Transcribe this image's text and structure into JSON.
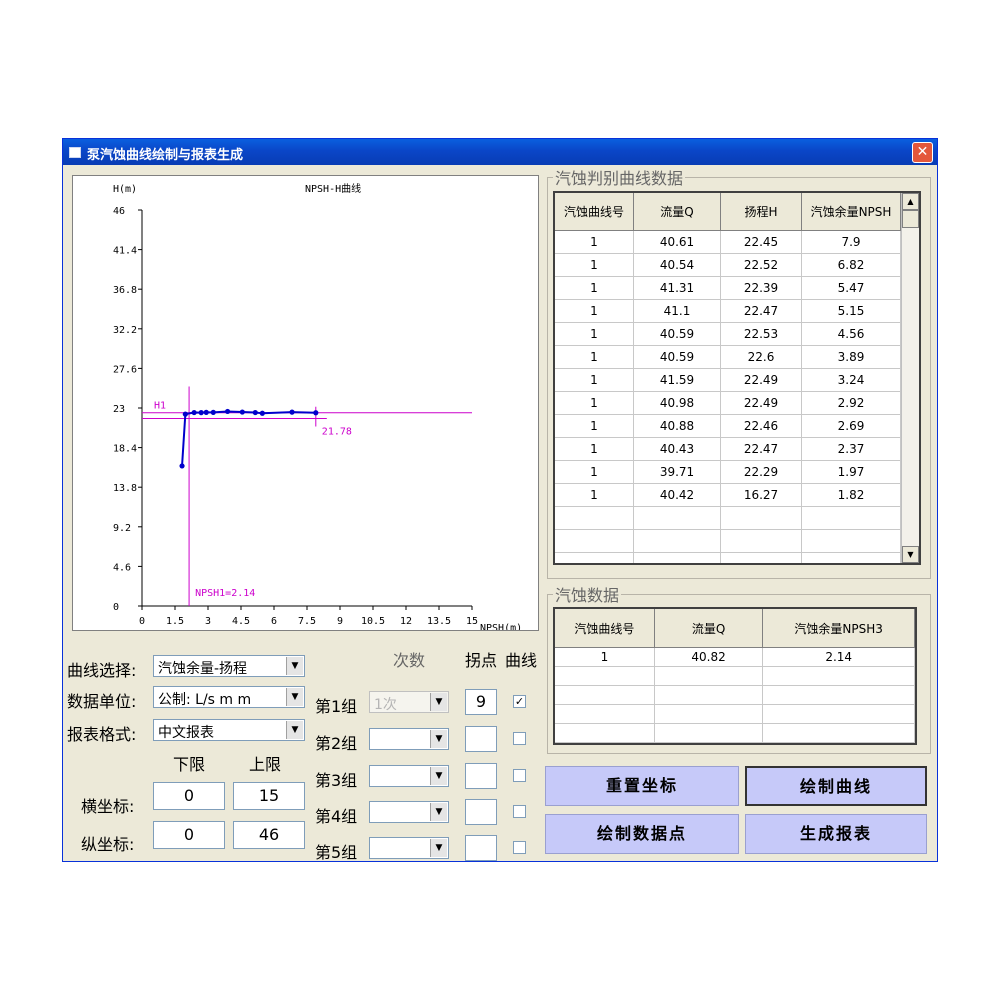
{
  "window": {
    "title": "泵汽蚀曲线绘制与报表生成",
    "close": "✕"
  },
  "plot": {
    "axes": {
      "ylabel": "H(m)",
      "xlabel": "NPSH(m)",
      "title": "NPSH-H曲线"
    },
    "chart_data": {
      "type": "scatter",
      "title": "NPSH-H曲线",
      "xlabel": "NPSH(m)",
      "ylabel": "H(m)",
      "xlim": [
        0,
        15
      ],
      "ylim": [
        0,
        46
      ],
      "x_ticks": [
        "0",
        "1.5",
        "3",
        "4.5",
        "6",
        "7.5",
        "9",
        "10.5",
        "12",
        "13.5",
        "15"
      ],
      "y_ticks": [
        "0",
        "4.6",
        "9.2",
        "13.8",
        "18.4",
        "23",
        "27.6",
        "32.2",
        "36.8",
        "41.4",
        "46"
      ],
      "series": [
        {
          "x": [
            7.9,
            6.82,
            5.47,
            5.15,
            4.56,
            3.89,
            3.24,
            2.92,
            2.69,
            2.37,
            1.97,
            1.82
          ],
          "y": [
            22.45,
            22.52,
            22.39,
            22.47,
            22.53,
            22.6,
            22.49,
            22.49,
            22.46,
            22.47,
            22.29,
            16.27
          ]
        }
      ],
      "annotations": {
        "h_line_label": "H1",
        "h_line_y": 22.45,
        "v_line_label": "NPSH1=2.14",
        "v_line_x": 2.14,
        "drop_line_y": 21.78,
        "drop_label": "21.78"
      },
      "grid": false,
      "legend": "none"
    }
  },
  "colors": {
    "series": "#0000cc",
    "guide": "#cc00cc"
  },
  "controls": {
    "curve_select_label": "曲线选择:",
    "curve_select_value": "汽蚀余量-扬程",
    "unit_label": "数据单位:",
    "unit_value": "公制: L/s m m",
    "report_label": "报表格式:",
    "report_value": "中文报表",
    "lower_label": "下限",
    "upper_label": "上限",
    "x_axis_label": "横坐标:",
    "x_lower": "0",
    "x_upper": "15",
    "y_axis_label": "纵坐标:",
    "y_lower": "0",
    "y_upper": "46",
    "count_header": "次数",
    "inflection_header": "拐点",
    "curve_header": "曲线",
    "groups": [
      {
        "label": "第1组",
        "count": "1次",
        "inflection": "9",
        "checked": "✓"
      },
      {
        "label": "第2组",
        "count": "",
        "inflection": "",
        "checked": ""
      },
      {
        "label": "第3组",
        "count": "",
        "inflection": "",
        "checked": ""
      },
      {
        "label": "第4组",
        "count": "",
        "inflection": "",
        "checked": ""
      },
      {
        "label": "第5组",
        "count": "",
        "inflection": "",
        "checked": ""
      }
    ]
  },
  "table1": {
    "title": "汽蚀判别曲线数据",
    "headers": [
      "汽蚀曲线号",
      "流量Q",
      "扬程H",
      "汽蚀余量NPSH"
    ],
    "rows": [
      [
        "1",
        "40.61",
        "22.45",
        "7.9"
      ],
      [
        "1",
        "40.54",
        "22.52",
        "6.82"
      ],
      [
        "1",
        "41.31",
        "22.39",
        "5.47"
      ],
      [
        "1",
        "41.1",
        "22.47",
        "5.15"
      ],
      [
        "1",
        "40.59",
        "22.53",
        "4.56"
      ],
      [
        "1",
        "40.59",
        "22.6",
        "3.89"
      ],
      [
        "1",
        "41.59",
        "22.49",
        "3.24"
      ],
      [
        "1",
        "40.98",
        "22.49",
        "2.92"
      ],
      [
        "1",
        "40.88",
        "22.46",
        "2.69"
      ],
      [
        "1",
        "40.43",
        "22.47",
        "2.37"
      ],
      [
        "1",
        "39.71",
        "22.29",
        "1.97"
      ],
      [
        "1",
        "40.42",
        "16.27",
        "1.82"
      ],
      [
        "",
        "",
        "",
        ""
      ],
      [
        "",
        "",
        "",
        ""
      ],
      [
        "",
        "",
        "",
        ""
      ]
    ]
  },
  "table2": {
    "title": "汽蚀数据",
    "headers": [
      "汽蚀曲线号",
      "流量Q",
      "汽蚀余量NPSH3"
    ],
    "rows": [
      [
        "1",
        "40.82",
        "2.14"
      ],
      [
        "",
        "",
        ""
      ],
      [
        "",
        "",
        ""
      ],
      [
        "",
        "",
        ""
      ],
      [
        "",
        "",
        ""
      ]
    ]
  },
  "buttons": {
    "reset": "重置坐标",
    "draw_curve": "绘制曲线",
    "draw_points": "绘制数据点",
    "report": "生成报表"
  },
  "scroll": {
    "up": "▲",
    "down": "▼"
  },
  "combo_arrow": "▼"
}
